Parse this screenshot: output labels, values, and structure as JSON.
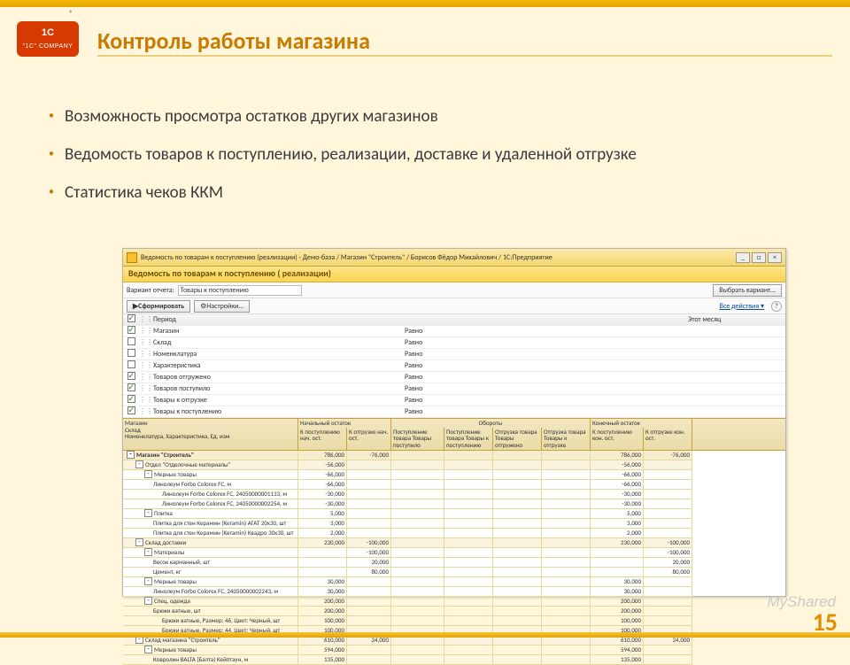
{
  "slide": {
    "title": "Контроль работы магазина",
    "bullets": [
      "Возможность просмотра остатков других магазинов",
      "Ведомость товаров к поступлению, реализации, доставке и удаленной отгрузке",
      "Статистика чеков ККМ"
    ],
    "pagenum": "15",
    "watermark": "MyShared"
  },
  "screenshot": {
    "title": "Ведомость по товарам к поступлению (реализации) - Демо-база / Магазин \"Строитель\" / Борисов Фёдор Михайлович / 1С:Предприятие",
    "report_title": "Ведомость по товарам к поступлению ( реализации)",
    "variant_label": "Вариант отчета:",
    "variant_value": "Товары к поступлению",
    "variant_btn": "Выбрать вариант...",
    "form_btn": "Сформировать",
    "settings_btn": "Настройки…",
    "all_actions": "Все действия ▾",
    "params_head_left": "Период",
    "params_head_right": "Этот месяц",
    "params": [
      {
        "chk": true,
        "name": "Магазин",
        "val": "Равно"
      },
      {
        "chk": false,
        "name": "Склад",
        "val": "Равно"
      },
      {
        "chk": false,
        "name": "Номенклатура",
        "val": "Равно"
      },
      {
        "chk": false,
        "name": "Характеристика",
        "val": "Равно"
      },
      {
        "chk": true,
        "name": "Товаров отгружено",
        "val": "Равно"
      },
      {
        "chk": true,
        "name": "Товаров поступило",
        "val": "Равно"
      },
      {
        "chk": true,
        "name": "Товары к отгрузке",
        "val": "Равно"
      },
      {
        "chk": true,
        "name": "Товары к поступлению",
        "val": "Равно"
      }
    ],
    "report_header": {
      "group1": [
        "Магазин",
        "Склад",
        "Номенклатура, Характеристика, Ед. изм"
      ],
      "nk": "Начальный остаток",
      "ob": "Обороты",
      "kk": "Конечный остаток",
      "sub": [
        "К поступлению нач. ост.",
        "К отгрузке нач. ост.",
        "Поступление товара Товары поступило",
        "Поступление товара Товары к поступлению",
        "Отгрузка товара Товары отгружено",
        "Отгрузка товара Товары к отгрузке",
        "К поступлению кон. ост.",
        "К отгрузке кон. ост."
      ]
    },
    "rows": [
      {
        "lvl": 0,
        "exp": "-",
        "name": "Магазин \"Строитель\"",
        "v": [
          "786,000",
          "-76,000",
          "",
          "",
          "",
          "",
          "786,000",
          "-76,000"
        ]
      },
      {
        "lvl": 1,
        "exp": "-",
        "name": "Отдел \"Отделочные материалы\"",
        "v": [
          "-56,000",
          "",
          "",
          "",
          "",
          "",
          "-56,000",
          ""
        ]
      },
      {
        "lvl": 2,
        "exp": "-",
        "name": "Мерные товары",
        "v": [
          "-66,000",
          "",
          "",
          "",
          "",
          "",
          "-66,000",
          ""
        ]
      },
      {
        "lvl": 3,
        "name": "Линолеум Forbo Coloreх FC, м",
        "v": [
          "-66,000",
          "",
          "",
          "",
          "",
          "",
          "-66,000",
          ""
        ]
      },
      {
        "lvl": 4,
        "name": "Линолеум Forbo Coloreх FC, 24050000001133, м",
        "v": [
          "-30,000",
          "",
          "",
          "",
          "",
          "",
          "-30,000",
          ""
        ]
      },
      {
        "lvl": 4,
        "name": "Линолеум Forbo Coloreх FC, 24050000002254, м",
        "v": [
          "-30,000",
          "",
          "",
          "",
          "",
          "",
          "-30,000",
          ""
        ]
      },
      {
        "lvl": 2,
        "exp": "-",
        "name": "Плитка",
        "v": [
          "5,000",
          "",
          "",
          "",
          "",
          "",
          "5,000",
          ""
        ]
      },
      {
        "lvl": 3,
        "name": "Плитка для стен Керамин (Keramin) АГАТ 20х30, шт",
        "v": [
          "3,000",
          "",
          "",
          "",
          "",
          "",
          "3,000",
          ""
        ]
      },
      {
        "lvl": 3,
        "name": "Плитка для стен Керамин (Keramin) Квадро 30х30, шт",
        "v": [
          "2,000",
          "",
          "",
          "",
          "",
          "",
          "2,000",
          ""
        ]
      },
      {
        "lvl": 1,
        "exp": "-",
        "name": "Склад доставки",
        "v": [
          "230,000",
          "-100,000",
          "",
          "",
          "",
          "",
          "230,000",
          "-100,000"
        ]
      },
      {
        "lvl": 2,
        "exp": "-",
        "name": "Материалы",
        "v": [
          "",
          "-100,000",
          "",
          "",
          "",
          "",
          "",
          "-100,000"
        ]
      },
      {
        "lvl": 3,
        "name": "Весок карманный, шт",
        "v": [
          "",
          "20,000",
          "",
          "",
          "",
          "",
          "",
          "20,000"
        ]
      },
      {
        "lvl": 3,
        "name": "Цемент, кг",
        "v": [
          "",
          "80,000",
          "",
          "",
          "",
          "",
          "",
          "80,000"
        ]
      },
      {
        "lvl": 2,
        "exp": "-",
        "name": "Мерные товары",
        "v": [
          "30,000",
          "",
          "",
          "",
          "",
          "",
          "30,000",
          ""
        ]
      },
      {
        "lvl": 3,
        "name": "Линолеум Forbo Coloreх FC, 24050000002243, м",
        "v": [
          "30,000",
          "",
          "",
          "",
          "",
          "",
          "30,000",
          ""
        ]
      },
      {
        "lvl": 2,
        "exp": "-",
        "name": "Спец. одежда",
        "v": [
          "200,000",
          "",
          "",
          "",
          "",
          "",
          "200,000",
          ""
        ]
      },
      {
        "lvl": 3,
        "name": "Брюки ватные, шт",
        "v": [
          "200,000",
          "",
          "",
          "",
          "",
          "",
          "200,000",
          ""
        ]
      },
      {
        "lvl": 4,
        "name": "Брюки ватные, Размер: 46, Цвет: Черный, шт",
        "v": [
          "100,000",
          "",
          "",
          "",
          "",
          "",
          "100,000",
          ""
        ]
      },
      {
        "lvl": 4,
        "name": "Брюки ватные, Размер: 44, Цвет: Черный, шт",
        "v": [
          "100,000",
          "",
          "",
          "",
          "",
          "",
          "100,000",
          ""
        ]
      },
      {
        "lvl": 1,
        "exp": "-",
        "name": "Склад магазина \"Строитель\"",
        "v": [
          "610,000",
          "24,000",
          "",
          "",
          "",
          "",
          "610,000",
          "24,000"
        ]
      },
      {
        "lvl": 2,
        "exp": "-",
        "name": "Мерные товары",
        "v": [
          "594,000",
          "",
          "",
          "",
          "",
          "",
          "594,000",
          ""
        ]
      },
      {
        "lvl": 3,
        "name": "Ковролин BALTA (Балта) Keйптаун, м",
        "v": [
          "135,000",
          "",
          "",
          "",
          "",
          "",
          "135,000",
          ""
        ]
      }
    ]
  }
}
